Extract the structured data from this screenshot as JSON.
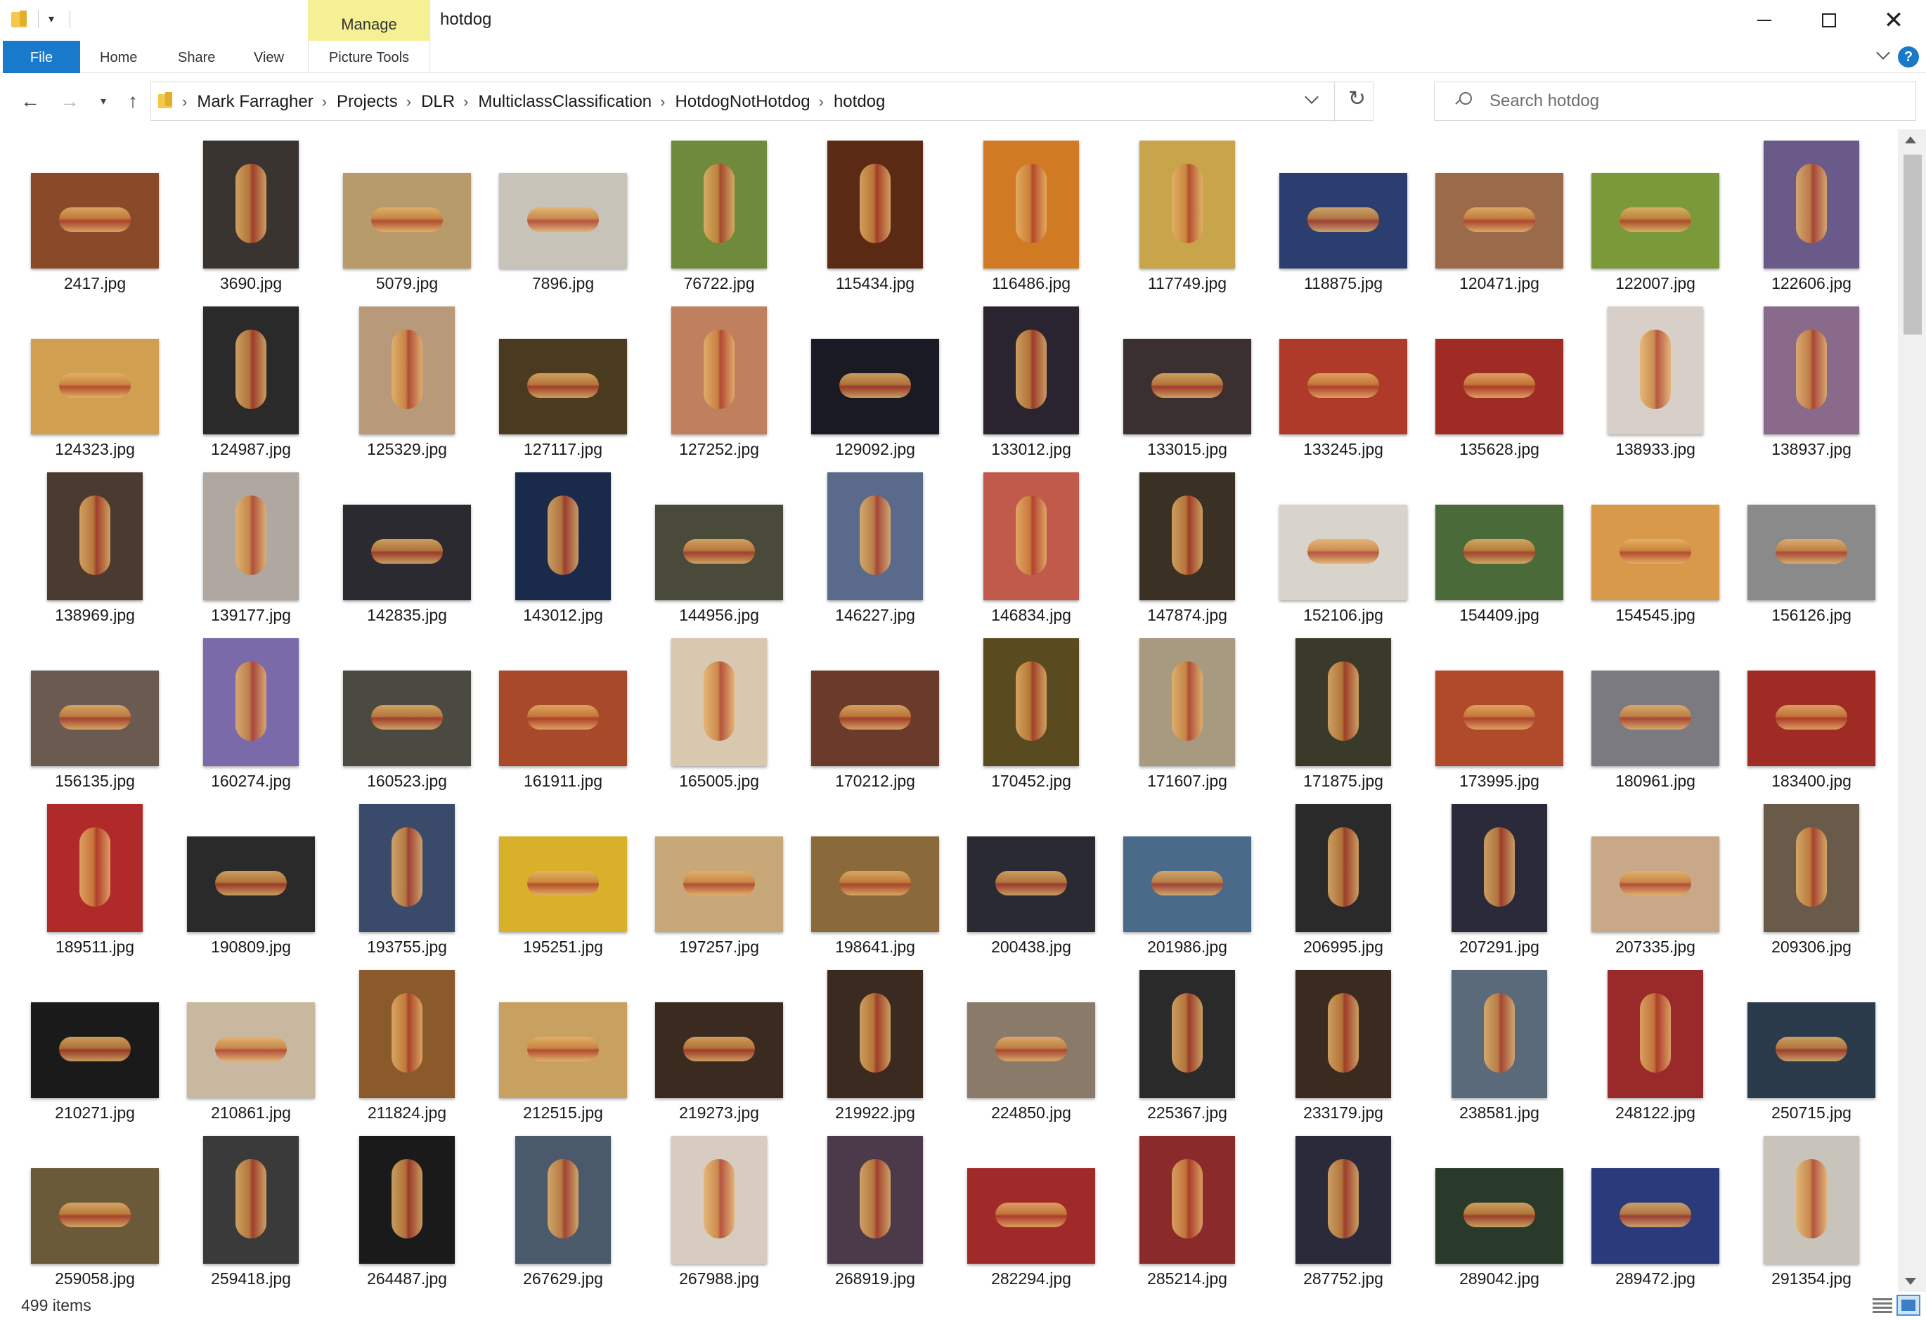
{
  "window": {
    "title": "hotdog",
    "manage_label": "Manage"
  },
  "ribbon": {
    "tabs": [
      {
        "id": "file",
        "label": "File"
      },
      {
        "id": "home",
        "label": "Home"
      },
      {
        "id": "share",
        "label": "Share"
      },
      {
        "id": "view",
        "label": "View"
      },
      {
        "id": "picture_tools",
        "label": "Picture Tools"
      }
    ]
  },
  "address": {
    "crumbs": [
      "Mark Farragher",
      "Projects",
      "DLR",
      "MulticlassClassification",
      "HotdogNotHotdog",
      "hotdog"
    ]
  },
  "search": {
    "placeholder": "Search hotdog"
  },
  "files": [
    {
      "name": "2417.jpg",
      "o": "land",
      "c": "#8a4a2a"
    },
    {
      "name": "3690.jpg",
      "o": "port",
      "c": "#3a3430"
    },
    {
      "name": "5079.jpg",
      "o": "land",
      "c": "#b89b6a"
    },
    {
      "name": "7896.jpg",
      "o": "land",
      "c": "#c7c3b8"
    },
    {
      "name": "76722.jpg",
      "o": "port",
      "c": "#6f8a3a"
    },
    {
      "name": "115434.jpg",
      "o": "port",
      "c": "#5a2a14"
    },
    {
      "name": "116486.jpg",
      "o": "port",
      "c": "#d07a24"
    },
    {
      "name": "117749.jpg",
      "o": "port",
      "c": "#c8a44a"
    },
    {
      "name": "118875.jpg",
      "o": "land",
      "c": "#2c3e70"
    },
    {
      "name": "120471.jpg",
      "o": "land",
      "c": "#9a6a4a"
    },
    {
      "name": "122007.jpg",
      "o": "land",
      "c": "#7a9a3a"
    },
    {
      "name": "122606.jpg",
      "o": "port",
      "c": "#6a5a8a"
    },
    {
      "name": "124323.jpg",
      "o": "land",
      "c": "#d0a050"
    },
    {
      "name": "124987.jpg",
      "o": "port",
      "c": "#2a2a2a"
    },
    {
      "name": "125329.jpg",
      "o": "port",
      "c": "#b89a7a"
    },
    {
      "name": "127117.jpg",
      "o": "land",
      "c": "#4a3a20"
    },
    {
      "name": "127252.jpg",
      "o": "port",
      "c": "#c08060"
    },
    {
      "name": "129092.jpg",
      "o": "land",
      "c": "#1a1a24"
    },
    {
      "name": "133012.jpg",
      "o": "port",
      "c": "#2a2430"
    },
    {
      "name": "133015.jpg",
      "o": "land",
      "c": "#3a3030"
    },
    {
      "name": "133245.jpg",
      "o": "land",
      "c": "#b03a2a"
    },
    {
      "name": "135628.jpg",
      "o": "land",
      "c": "#a02a24"
    },
    {
      "name": "138933.jpg",
      "o": "port",
      "c": "#d8d0c8"
    },
    {
      "name": "138937.jpg",
      "o": "port",
      "c": "#8a6a8a"
    },
    {
      "name": "138969.jpg",
      "o": "port",
      "c": "#4a3a30"
    },
    {
      "name": "139177.jpg",
      "o": "port",
      "c": "#b0a8a0"
    },
    {
      "name": "142835.jpg",
      "o": "land",
      "c": "#2a2a30"
    },
    {
      "name": "143012.jpg",
      "o": "port",
      "c": "#1a2a4a"
    },
    {
      "name": "144956.jpg",
      "o": "land",
      "c": "#4a4a3a"
    },
    {
      "name": "146227.jpg",
      "o": "port",
      "c": "#5a6a8a"
    },
    {
      "name": "146834.jpg",
      "o": "port",
      "c": "#c05a4a"
    },
    {
      "name": "147874.jpg",
      "o": "port",
      "c": "#3a3024"
    },
    {
      "name": "152106.jpg",
      "o": "land",
      "c": "#d8d4cc"
    },
    {
      "name": "154409.jpg",
      "o": "land",
      "c": "#4a6a3a"
    },
    {
      "name": "154545.jpg",
      "o": "land",
      "c": "#d89a4a"
    },
    {
      "name": "156126.jpg",
      "o": "land",
      "c": "#8a8a8a"
    },
    {
      "name": "156135.jpg",
      "o": "land",
      "c": "#6a5a50"
    },
    {
      "name": "160274.jpg",
      "o": "port",
      "c": "#7a6aaa"
    },
    {
      "name": "160523.jpg",
      "o": "land",
      "c": "#4a4a40"
    },
    {
      "name": "161911.jpg",
      "o": "land",
      "c": "#a84a2a"
    },
    {
      "name": "165005.jpg",
      "o": "port",
      "c": "#d8c8b0"
    },
    {
      "name": "170212.jpg",
      "o": "land",
      "c": "#6a3a2a"
    },
    {
      "name": "170452.jpg",
      "o": "port",
      "c": "#5a4a20"
    },
    {
      "name": "171607.jpg",
      "o": "port",
      "c": "#a89a80"
    },
    {
      "name": "171875.jpg",
      "o": "port",
      "c": "#3a3a2a"
    },
    {
      "name": "173995.jpg",
      "o": "land",
      "c": "#b04a2a"
    },
    {
      "name": "180961.jpg",
      "o": "land",
      "c": "#7a7a80"
    },
    {
      "name": "183400.jpg",
      "o": "land",
      "c": "#a02a24"
    },
    {
      "name": "189511.jpg",
      "o": "port",
      "c": "#b02a2a"
    },
    {
      "name": "190809.jpg",
      "o": "land",
      "c": "#2a2a2a"
    },
    {
      "name": "193755.jpg",
      "o": "port",
      "c": "#3a4a6a"
    },
    {
      "name": "195251.jpg",
      "o": "land",
      "c": "#d8b02a"
    },
    {
      "name": "197257.jpg",
      "o": "land",
      "c": "#c8a878"
    },
    {
      "name": "198641.jpg",
      "o": "land",
      "c": "#8a6a3a"
    },
    {
      "name": "200438.jpg",
      "o": "land",
      "c": "#2a2a34"
    },
    {
      "name": "201986.jpg",
      "o": "land",
      "c": "#4a6a8a"
    },
    {
      "name": "206995.jpg",
      "o": "port",
      "c": "#2a2a2a"
    },
    {
      "name": "207291.jpg",
      "o": "port",
      "c": "#2a2a3a"
    },
    {
      "name": "207335.jpg",
      "o": "land",
      "c": "#c8a888"
    },
    {
      "name": "209306.jpg",
      "o": "port",
      "c": "#6a5a4a"
    },
    {
      "name": "210271.jpg",
      "o": "land",
      "c": "#1a1a1a"
    },
    {
      "name": "210861.jpg",
      "o": "land",
      "c": "#c8b8a0"
    },
    {
      "name": "211824.jpg",
      "o": "port",
      "c": "#8a5a2a"
    },
    {
      "name": "212515.jpg",
      "o": "land",
      "c": "#c8a060"
    },
    {
      "name": "219273.jpg",
      "o": "land",
      "c": "#3a2a20"
    },
    {
      "name": "219922.jpg",
      "o": "port",
      "c": "#3a2a20"
    },
    {
      "name": "224850.jpg",
      "o": "land",
      "c": "#8a7a6a"
    },
    {
      "name": "225367.jpg",
      "o": "port",
      "c": "#2a2a2a"
    },
    {
      "name": "233179.jpg",
      "o": "port",
      "c": "#3a2a20"
    },
    {
      "name": "238581.jpg",
      "o": "port",
      "c": "#5a6a7a"
    },
    {
      "name": "248122.jpg",
      "o": "port",
      "c": "#9a2a2a"
    },
    {
      "name": "250715.jpg",
      "o": "land",
      "c": "#2a3a4a"
    },
    {
      "name": "259058.jpg",
      "o": "land",
      "c": "#6a5a3a"
    },
    {
      "name": "259418.jpg",
      "o": "port",
      "c": "#3a3a3a"
    },
    {
      "name": "264487.jpg",
      "o": "port",
      "c": "#1a1a1a"
    },
    {
      "name": "267629.jpg",
      "o": "port",
      "c": "#4a5a6a"
    },
    {
      "name": "267988.jpg",
      "o": "port",
      "c": "#d8ccc0"
    },
    {
      "name": "268919.jpg",
      "o": "port",
      "c": "#4a3a4a"
    },
    {
      "name": "282294.jpg",
      "o": "land",
      "c": "#a02a2a"
    },
    {
      "name": "285214.jpg",
      "o": "port",
      "c": "#8a2a2a"
    },
    {
      "name": "287752.jpg",
      "o": "port",
      "c": "#2a2a3a"
    },
    {
      "name": "289042.jpg",
      "o": "land",
      "c": "#2a3a2a"
    },
    {
      "name": "289472.jpg",
      "o": "land",
      "c": "#2a3a7a"
    },
    {
      "name": "291354.jpg",
      "o": "port",
      "c": "#c8c4bc"
    }
  ],
  "status": {
    "item_count": "499 items"
  },
  "colors": {
    "accent": "#1979ca",
    "contextual_tab": "#f5f094",
    "folder": "#f3c94a"
  },
  "icons": {
    "back": "arrow-left-icon",
    "forward": "arrow-right-icon",
    "up": "arrow-up-icon",
    "refresh": "refresh-icon",
    "search": "search-icon",
    "help": "help-icon"
  }
}
